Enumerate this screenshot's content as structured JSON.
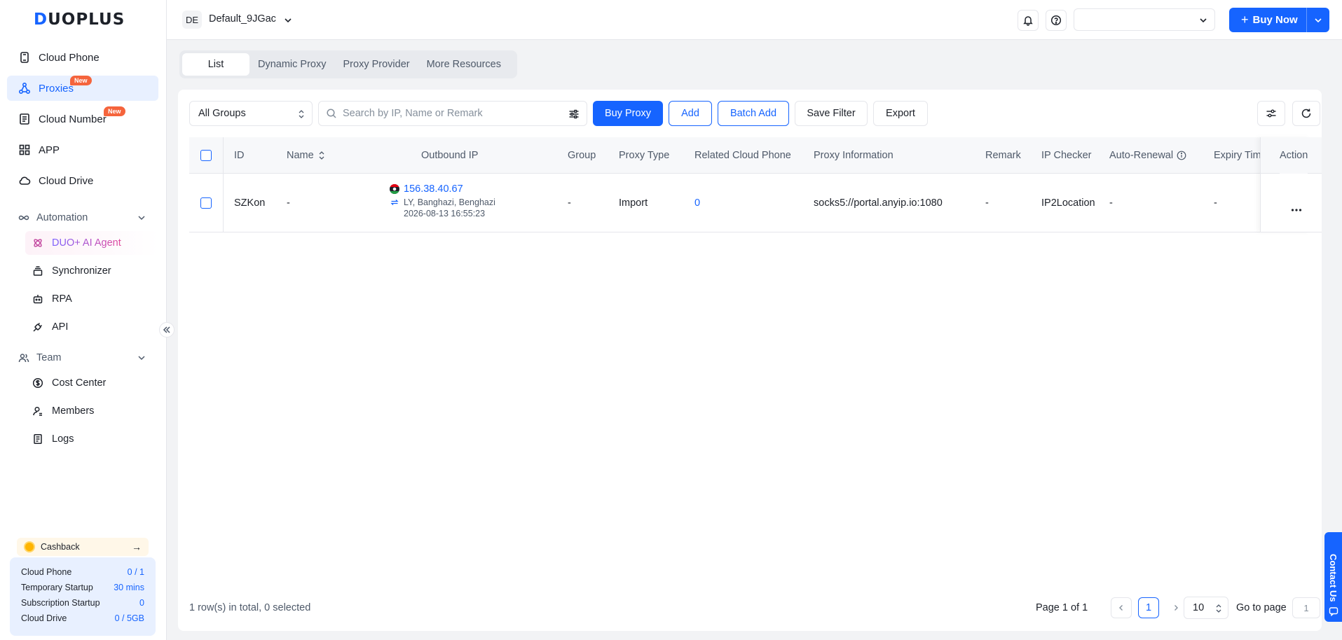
{
  "brand": {
    "logo_prefix": "D",
    "logo_rest": "UOPLUS"
  },
  "sidebar": {
    "nav": [
      {
        "label": "Cloud Phone",
        "icon": "phone-icon"
      },
      {
        "label": "Proxies",
        "icon": "network-icon",
        "badge": "New"
      },
      {
        "label": "Cloud Number",
        "icon": "doc-icon",
        "badge": "New"
      },
      {
        "label": "APP",
        "icon": "grid-icon"
      },
      {
        "label": "Cloud Drive",
        "icon": "cloud-icon"
      }
    ],
    "automation": {
      "label": "Automation",
      "items": [
        {
          "label": "DUO+ AI Agent",
          "icon": "ai-agent-icon"
        },
        {
          "label": "Synchronizer",
          "icon": "stack-icon"
        },
        {
          "label": "RPA",
          "icon": "robot-icon"
        },
        {
          "label": "API",
          "icon": "plug-icon"
        }
      ]
    },
    "team": {
      "label": "Team",
      "items": [
        {
          "label": "Cost Center",
          "icon": "dollar-icon"
        },
        {
          "label": "Members",
          "icon": "user-icon"
        },
        {
          "label": "Logs",
          "icon": "log-icon"
        }
      ]
    },
    "cashback": {
      "label": "Cashback",
      "arrow": "→"
    },
    "quota": [
      {
        "label": "Cloud Phone",
        "value": "0 / 1"
      },
      {
        "label": "Temporary Startup",
        "value": "30 mins"
      },
      {
        "label": "Subscription Startup",
        "value": "0"
      },
      {
        "label": "Cloud Drive",
        "value": "0 / 5GB"
      }
    ]
  },
  "topbar": {
    "workspace_initials": "DE",
    "workspace_name": "Default_9JGac",
    "select_value": "",
    "buy_now_label": "Buy Now",
    "buy_now_plus": "+"
  },
  "tabs": [
    {
      "label": "List",
      "active": true
    },
    {
      "label": "Dynamic Proxy"
    },
    {
      "label": "Proxy Provider"
    },
    {
      "label": "More Resources"
    }
  ],
  "toolbar": {
    "group_select": "All Groups",
    "search_placeholder": "Search by IP, Name or Remark",
    "buy_proxy": "Buy Proxy",
    "add": "Add",
    "batch_add": "Batch Add",
    "save_filter": "Save Filter",
    "export": "Export"
  },
  "table": {
    "columns": {
      "id": "ID",
      "name": "Name",
      "outbound_ip": "Outbound IP",
      "group": "Group",
      "proxy_type": "Proxy Type",
      "related_cloud_phone": "Related Cloud Phone",
      "proxy_information": "Proxy Information",
      "remark": "Remark",
      "ip_checker": "IP Checker",
      "auto_renewal": "Auto-Renewal",
      "expiry_time": "Expiry Tim",
      "action": "Action"
    },
    "rows": [
      {
        "id": "SZKon",
        "name": "-",
        "ip": "156.38.40.67",
        "location": "LY, Banghazi, Benghazi",
        "ip_time": "2026-08-13 16:55:23",
        "group": "-",
        "proxy_type": "Import",
        "related_cloud_phone": "0",
        "proxy_information": "socks5://portal.anyip.io:1080",
        "remark": "-",
        "ip_checker": "IP2Location",
        "auto_renewal": "-",
        "expiry_time": "-",
        "action": "···"
      }
    ]
  },
  "footer": {
    "total_text": "1 row(s) in total, 0 selected",
    "page_text": "Page 1 of 1",
    "current_page": "1",
    "page_size": "10",
    "goto_label": "Go to page",
    "goto_value": "1"
  },
  "contact": {
    "label": "Contact Us"
  },
  "colors": {
    "primary": "#1664ff",
    "badge": "#f5643c",
    "active_bg": "#e8f0ff"
  }
}
